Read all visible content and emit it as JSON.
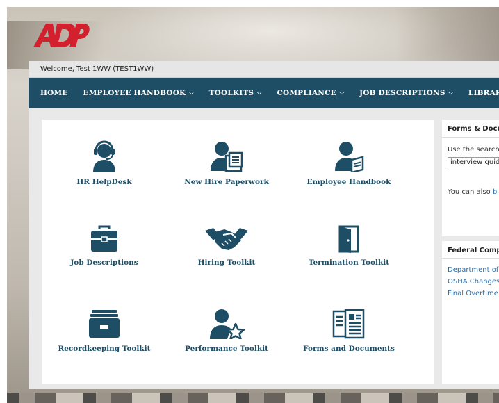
{
  "brand": {
    "logo_text": "ADP",
    "logo_color": "#d2202f"
  },
  "welcome": {
    "text": "Welcome, Test 1WW (TEST1WW)"
  },
  "nav": {
    "items": [
      {
        "label": "HOME",
        "dropdown": false
      },
      {
        "label": "EMPLOYEE HANDBOOK",
        "dropdown": true
      },
      {
        "label": "TOOLKITS",
        "dropdown": true
      },
      {
        "label": "COMPLIANCE",
        "dropdown": true
      },
      {
        "label": "JOB DESCRIPTIONS",
        "dropdown": true
      },
      {
        "label": "LIBRARY",
        "dropdown": true
      }
    ],
    "background": "#1d4e66"
  },
  "tiles": [
    {
      "label": "HR HelpDesk",
      "icon": "headset-person-icon"
    },
    {
      "label": "New Hire Paperwork",
      "icon": "person-document-icon"
    },
    {
      "label": "Employee Handbook",
      "icon": "person-book-icon"
    },
    {
      "label": "Job Descriptions",
      "icon": "toolbox-icon"
    },
    {
      "label": "Hiring Toolkit",
      "icon": "handshake-icon"
    },
    {
      "label": "Termination Toolkit",
      "icon": "door-icon"
    },
    {
      "label": "Recordkeeping Toolkit",
      "icon": "file-drawer-icon"
    },
    {
      "label": "Performance Toolkit",
      "icon": "person-star-icon"
    },
    {
      "label": "Forms and Documents",
      "icon": "documents-icon"
    }
  ],
  "forms_panel": {
    "title": "Forms & Docu",
    "instruction": "Use the search",
    "search_value": "interview guid",
    "browse_prefix": "You can also ",
    "browse_link": "b"
  },
  "federal_panel": {
    "title": "Federal Comp",
    "links": [
      "Department of",
      "OSHA Changes",
      "Final Overtime"
    ]
  },
  "colors": {
    "accent": "#1d4e66",
    "link": "#2a6ea8"
  }
}
